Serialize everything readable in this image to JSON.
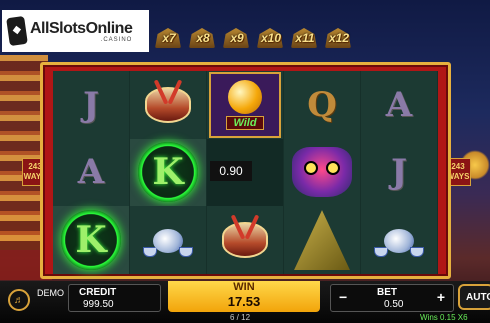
{
  "logo": {
    "text": "AllSlotsOnline",
    "sub": ".CASINO"
  },
  "multipliers": [
    "x7",
    "x8",
    "x9",
    "x10",
    "x11",
    "x12"
  ],
  "ways": {
    "count": "243",
    "label": "WAYS"
  },
  "reels": [
    [
      {
        "sym": "letter",
        "text": "J",
        "style": "purple"
      },
      {
        "sym": "letter",
        "text": "A",
        "style": "purple"
      },
      {
        "sym": "k",
        "text": "K"
      }
    ],
    [
      {
        "sym": "drum"
      },
      {
        "sym": "k",
        "text": "K"
      },
      {
        "sym": "teapot"
      }
    ],
    [
      {
        "sym": "wild",
        "text": "Wild"
      },
      {
        "sym": "blank"
      },
      {
        "sym": "drum"
      }
    ],
    [
      {
        "sym": "letter",
        "text": "Q",
        "style": "gold"
      },
      {
        "sym": "dragon"
      },
      {
        "sym": "zongzi"
      }
    ],
    [
      {
        "sym": "letter",
        "text": "A",
        "style": "purple"
      },
      {
        "sym": "letter",
        "text": "J",
        "style": "purple"
      },
      {
        "sym": "teapot"
      }
    ]
  ],
  "win_popup": "0.90",
  "bottom": {
    "mode": "DEMO",
    "credit_label": "CREDIT",
    "credit_value": "999.50",
    "win_label": "WIN",
    "win_value": "17.53",
    "page": "6 / 12",
    "bet_label": "BET",
    "bet_value": "0.50",
    "minus": "−",
    "plus": "+",
    "auto_label": "AUTO",
    "wins_note": "Wins 0.15 X6"
  }
}
